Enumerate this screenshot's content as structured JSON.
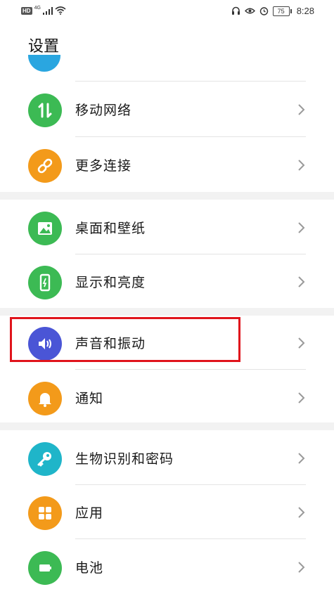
{
  "status_bar": {
    "hd": "HD",
    "network": "4G",
    "battery": "75",
    "time": "8:28"
  },
  "page": {
    "title": "设置"
  },
  "items": [
    {
      "label": "移动网络",
      "icon": "updown-arrows-icon",
      "color": "#3cba54"
    },
    {
      "label": "更多连接",
      "icon": "link-icon",
      "color": "#f39a1a"
    },
    {
      "label": "桌面和壁纸",
      "icon": "image-icon",
      "color": "#3cba54"
    },
    {
      "label": "显示和亮度",
      "icon": "phone-brightness-icon",
      "color": "#3cba54"
    },
    {
      "label": "声音和振动",
      "icon": "speaker-icon",
      "color": "#4a55d6"
    },
    {
      "label": "通知",
      "icon": "bell-icon",
      "color": "#f39a1a"
    },
    {
      "label": "生物识别和密码",
      "icon": "key-icon",
      "color": "#1fb5c9"
    },
    {
      "label": "应用",
      "icon": "grid-icon",
      "color": "#f39a1a"
    },
    {
      "label": "电池",
      "icon": "battery-icon",
      "color": "#3cba54"
    }
  ],
  "highlight_color": "#e0141c"
}
